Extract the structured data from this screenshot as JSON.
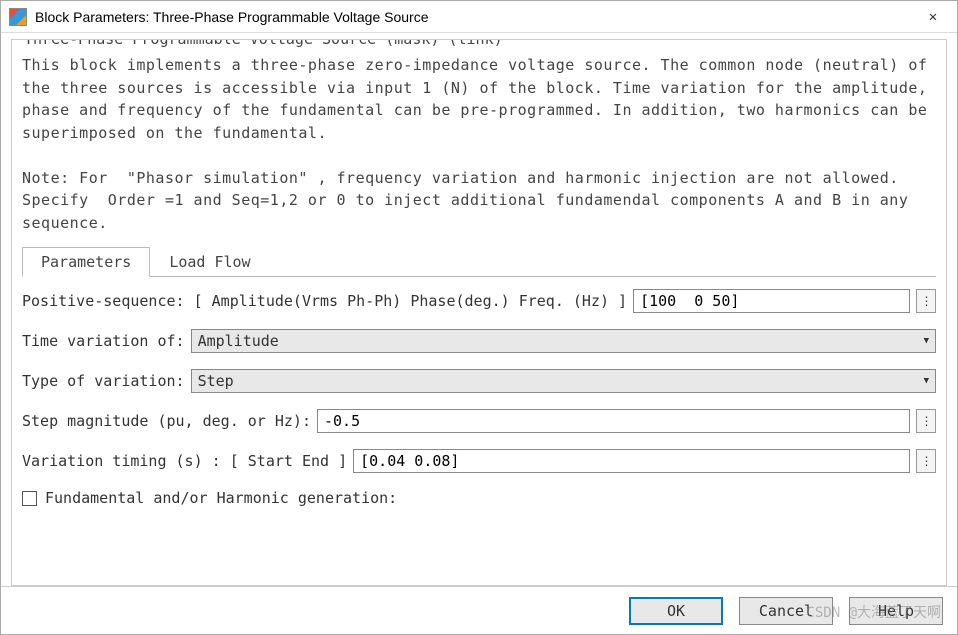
{
  "titlebar": {
    "title": "Block Parameters: Three-Phase Programmable Voltage Source"
  },
  "fieldset": {
    "legend": "Three-Phase Programmable Voltage Source (mask) (link)",
    "description": "This block implements a three-phase zero-impedance voltage source. The common node (neutral) of the three sources is accessible via input 1 (N) of the block. Time variation for the amplitude, phase and frequency of the fundamental can be pre-programmed. In addition, two harmonics can be superimposed on the fundamental.\n\nNote: For  \"Phasor simulation\" , frequency variation and harmonic injection are not allowed. Specify  Order =1 and Seq=1,2 or 0 to inject additional fundamendal components A and B in any sequence."
  },
  "tabs": {
    "items": [
      {
        "label": "Parameters",
        "active": true
      },
      {
        "label": "Load Flow",
        "active": false
      }
    ]
  },
  "params": {
    "pos_seq_label": "Positive-sequence: [ Amplitude(Vrms Ph-Ph)  Phase(deg.)   Freq. (Hz) ]",
    "pos_seq_value": "[100  0 50]",
    "time_var_label": "Time variation of:",
    "time_var_value": "Amplitude",
    "type_var_label": "Type of variation:",
    "type_var_value": "Step",
    "step_mag_label": "Step magnitude (pu, deg. or Hz):",
    "step_mag_value": "-0.5",
    "var_timing_label": "Variation timing (s) : [ Start   End ]",
    "var_timing_value": "[0.04 0.08]",
    "harmonic_label": "Fundamental and/or Harmonic generation:",
    "harmonic_checked": false
  },
  "footer": {
    "ok": "OK",
    "cancel": "Cancel",
    "help": "Help"
  },
  "watermark": "CSDN @大海蓝了天啊"
}
